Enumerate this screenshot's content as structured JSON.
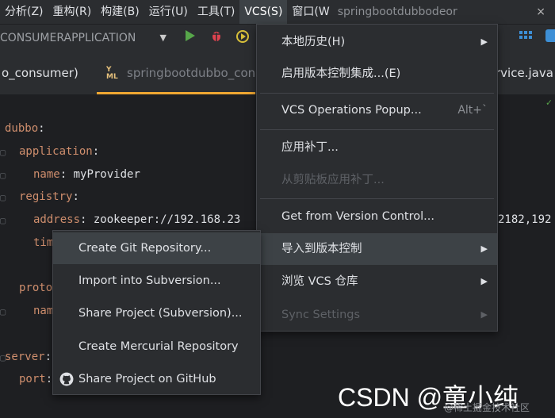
{
  "menubar": {
    "items": [
      "分析(Z)",
      "重构(R)",
      "构建(B)",
      "运行(U)",
      "工具(T)",
      "VCS(S)",
      "窗口(W"
    ],
    "project": "springbootdubbodeor",
    "close": "×"
  },
  "toolbar": {
    "run_config": "CONSUMERAPPLICATION",
    "dropdown": "▼"
  },
  "tabs": {
    "left_tab": "o_consumer)",
    "active_tab": "springbootdubbo_con",
    "right_tab": "rvice.java"
  },
  "editor": {
    "lines": [
      {
        "key": "dubbo",
        "sep": ":",
        "value": ""
      },
      {
        "key": "application",
        "sep": ":",
        "value": ""
      },
      {
        "key": "name",
        "sep": ":",
        "value": " myProvider"
      },
      {
        "key": "registry",
        "sep": ":",
        "value": ""
      },
      {
        "key": "address",
        "sep": ":",
        "value": " zookeeper://192.168.23"
      },
      {
        "key": "tim",
        "sep": "",
        "value": ""
      },
      {
        "key": "proto",
        "sep": "",
        "value": ""
      },
      {
        "key": "nam",
        "sep": "",
        "value": ""
      },
      {
        "key": "server",
        "sep": ":",
        "value": ""
      },
      {
        "key": "port",
        "sep": ":",
        "value": ""
      }
    ],
    "right_fragment": "2182,192"
  },
  "vcs_menu": {
    "items": [
      {
        "label": "本地历史(H)",
        "submenu": true,
        "disabled": false
      },
      {
        "label": "启用版本控制集成...(E)",
        "submenu": false,
        "disabled": false
      },
      {
        "label": "VCS Operations Popup...",
        "shortcut": "Alt+`",
        "submenu": false,
        "disabled": false
      },
      {
        "label": "应用补丁...",
        "submenu": false,
        "disabled": false
      },
      {
        "label": "从剪贴板应用补丁...",
        "submenu": false,
        "disabled": true
      },
      {
        "label": "Get from Version Control...",
        "submenu": false,
        "disabled": false
      },
      {
        "label": "导入到版本控制",
        "submenu": true,
        "disabled": false
      },
      {
        "label": "浏览 VCS 仓库",
        "submenu": true,
        "disabled": false
      },
      {
        "label": "Sync Settings",
        "submenu": true,
        "disabled": true
      }
    ]
  },
  "import_submenu": {
    "items": [
      "Create Git Repository...",
      "Import into Subversion...",
      "Share Project (Subversion)...",
      "Create Mercurial Repository",
      "Share Project on GitHub"
    ]
  },
  "watermark": {
    "main": "CSDN @童小纯",
    "sub": "@稀土掘金技术社区"
  }
}
